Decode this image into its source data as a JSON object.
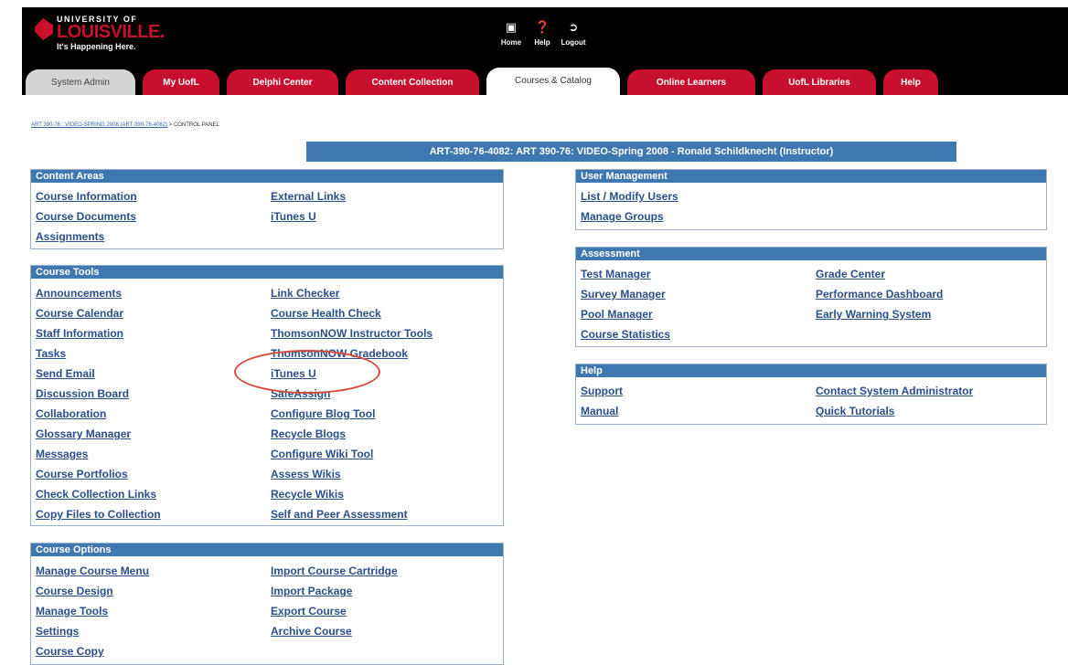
{
  "header": {
    "logo": {
      "top_line": "UNIVERSITY OF",
      "main": "LOUISVILLE.",
      "tagline": "It's Happening Here."
    },
    "utility": [
      {
        "label": "Home",
        "icon": "home-icon"
      },
      {
        "label": "Help",
        "icon": "help-icon"
      },
      {
        "label": "Logout",
        "icon": "logout-icon"
      }
    ]
  },
  "tabs": [
    {
      "label": "System Admin",
      "style": "gray"
    },
    {
      "label": "My UofL",
      "style": "red"
    },
    {
      "label": "Delphi Center",
      "style": "red"
    },
    {
      "label": "Content Collection",
      "style": "red"
    },
    {
      "label": "Courses & Catalog",
      "style": "active"
    },
    {
      "label": "Online Learners",
      "style": "red"
    },
    {
      "label": "UofL Libraries",
      "style": "red"
    },
    {
      "label": "Help",
      "style": "red"
    }
  ],
  "breadcrumb": {
    "course_link": "ART 390-76 : VIDEO-SPRING 2008 (ART-390-76-4082)",
    "separator": ">",
    "current": "CONTROL PANEL"
  },
  "course_title": "ART-390-76-4082: ART 390-76: VIDEO-Spring 2008 - Ronald Schildknecht (Instructor)",
  "panels": {
    "content_areas": {
      "title": "Content Areas",
      "left": [
        "Course Information",
        "Course Documents",
        "Assignments"
      ],
      "right": [
        "External Links",
        "iTunes U"
      ]
    },
    "course_tools": {
      "title": "Course Tools",
      "left": [
        "Announcements",
        "Course Calendar",
        "Staff Information",
        "Tasks",
        "Send Email",
        "Discussion Board",
        "Collaboration",
        "Glossary Manager",
        "Messages",
        "Course Portfolios",
        "Check Collection Links",
        "Copy Files to Collection"
      ],
      "right": [
        "Link Checker",
        "Course Health Check",
        "ThomsonNOW Instructor Tools",
        "ThomsonNOW Gradebook",
        "iTunes U",
        "SafeAssign",
        "Configure Blog Tool",
        "Recycle Blogs",
        "Configure Wiki Tool",
        "Assess Wikis",
        "Recycle Wikis",
        "Self and Peer Assessment"
      ]
    },
    "course_options": {
      "title": "Course Options",
      "left": [
        "Manage Course Menu",
        "Course Design",
        "Manage Tools",
        "Settings",
        "Course Copy"
      ],
      "right": [
        "Import Course Cartridge",
        "Import Package",
        "Export Course",
        "Archive Course"
      ]
    },
    "user_management": {
      "title": "User Management",
      "left": [
        "List / Modify Users",
        "Manage Groups"
      ],
      "right": []
    },
    "assessment": {
      "title": "Assessment",
      "left": [
        "Test Manager",
        "Survey Manager",
        "Pool Manager",
        "Course Statistics"
      ],
      "right": [
        "Grade Center",
        "Performance Dashboard",
        "Early Warning System"
      ]
    },
    "help": {
      "title": "Help",
      "left": [
        "Support",
        "Manual"
      ],
      "right": [
        "Contact System Administrator",
        "Quick Tutorials"
      ]
    }
  },
  "colors": {
    "brand_red": "#c8102e",
    "header_bg": "#000000",
    "panel_blue": "#3f78b0",
    "link_blue": "#2a4f8a",
    "annotation_red": "#d94a3b"
  }
}
